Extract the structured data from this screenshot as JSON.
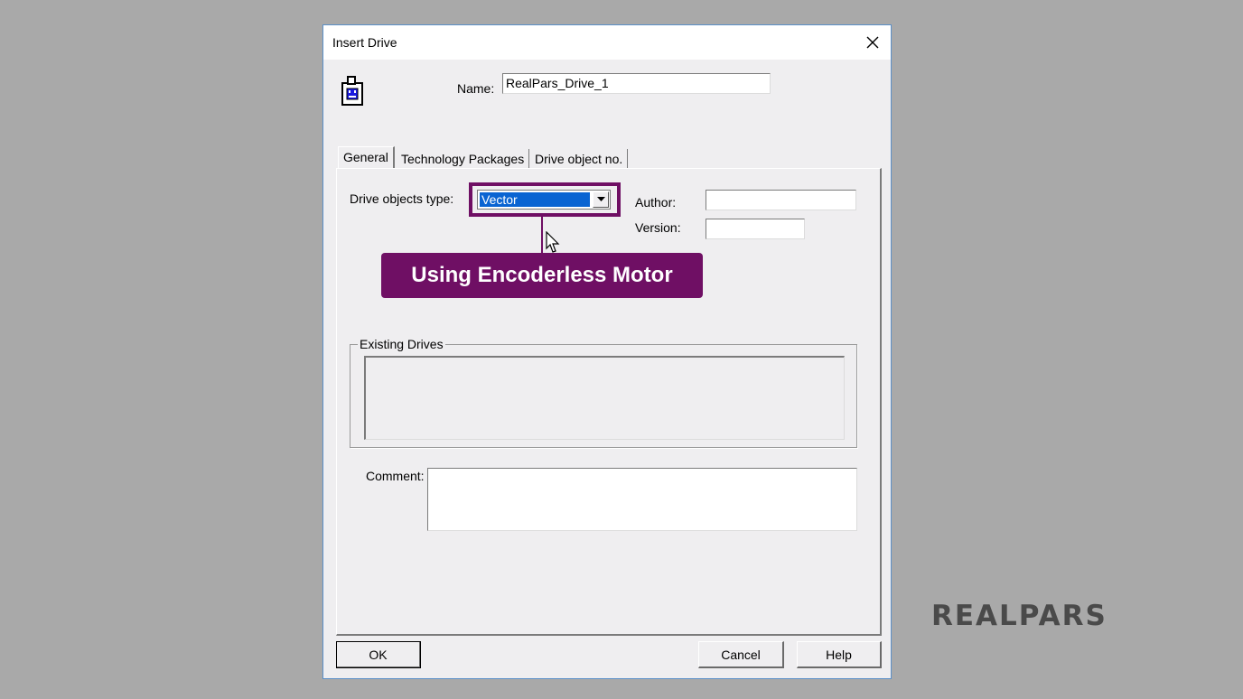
{
  "dialog": {
    "title": "Insert Drive",
    "name_label": "Name:",
    "name_value": "RealPars_Drive_1"
  },
  "tabs": [
    {
      "label": "General",
      "active": true
    },
    {
      "label": "Technology Packages",
      "active": false
    },
    {
      "label": "Drive object no.",
      "active": false
    }
  ],
  "general": {
    "drive_type_label": "Drive objects type:",
    "drive_type_value": "Vector",
    "author_label": "Author:",
    "author_value": "",
    "version_label": "Version:",
    "version_value": "",
    "existing_drives_label": "Existing Drives",
    "comment_label": "Comment:",
    "comment_value": ""
  },
  "callout": {
    "text": "Using Encoderless Motor"
  },
  "buttons": {
    "ok": "OK",
    "cancel": "Cancel",
    "help": "Help"
  },
  "branding": {
    "logo_text": "REALPARS"
  },
  "colors": {
    "background": "#a9a9a9",
    "dialog": "#efeef0",
    "callout": "#6f0f64",
    "selection": "#0a64d2"
  }
}
